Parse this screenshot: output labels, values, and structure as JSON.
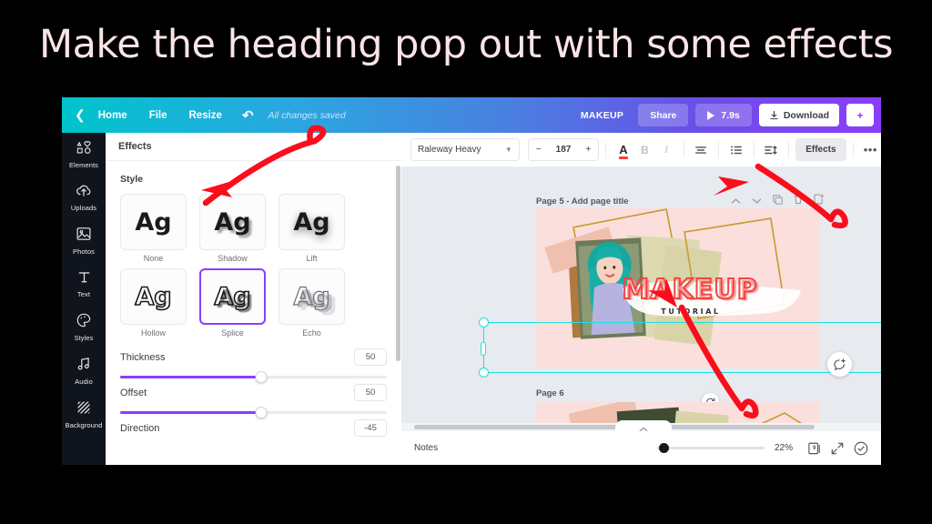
{
  "title": "Make the heading pop out with some effects",
  "topbar": {
    "back_icon": "chevron-left-icon",
    "home": "Home",
    "file": "File",
    "resize": "Resize",
    "undo_icon": "undo-icon",
    "saved_status": "All changes saved",
    "project_name": "MAKEUP",
    "share": "Share",
    "play_duration": "7.9s",
    "download": "Download",
    "gradient_start": "#00c4cc",
    "gradient_end": "#8b3dfb"
  },
  "rail": {
    "items": [
      {
        "label": "Elements",
        "icon": "shapes-icon"
      },
      {
        "label": "Uploads",
        "icon": "cloud-upload-icon"
      },
      {
        "label": "Photos",
        "icon": "image-icon"
      },
      {
        "label": "Text",
        "icon": "text-icon"
      },
      {
        "label": "Styles",
        "icon": "palette-icon"
      },
      {
        "label": "Audio",
        "icon": "music-note-icon"
      },
      {
        "label": "Background",
        "icon": "hatch-pattern-icon"
      }
    ]
  },
  "panel": {
    "header": "Effects",
    "style_label": "Style",
    "styles": [
      {
        "name": "None",
        "selected": false
      },
      {
        "name": "Shadow",
        "selected": false
      },
      {
        "name": "Lift",
        "selected": false
      },
      {
        "name": "Hollow",
        "selected": false
      },
      {
        "name": "Splice",
        "selected": true
      },
      {
        "name": "Echo",
        "selected": false
      }
    ],
    "sample_glyph": "Ag",
    "selected_color": "#8b3dfb",
    "sliders": [
      {
        "label": "Thickness",
        "value": "50"
      },
      {
        "label": "Offset",
        "value": "50"
      },
      {
        "label": "Direction",
        "value": "-45"
      }
    ]
  },
  "formatbar": {
    "font_name": "Raleway Heavy",
    "chevron_icon": "chevron-down-icon",
    "minus": "−",
    "font_size": "187",
    "plus": "+",
    "text_color_icon": "text-color-icon",
    "text_color": "#ff3b30",
    "bold_icon": "bold-icon",
    "bold_glyph": "B",
    "italic_icon": "italic-icon",
    "italic_glyph": "I",
    "align_icon": "align-center-icon",
    "list_icon": "bullet-list-icon",
    "spacing_icon": "line-spacing-icon",
    "effects_button": "Effects",
    "more_icon": "more-horizontal-icon",
    "more_glyph": "•••"
  },
  "canvas": {
    "page5_title": "Page 5 - Add page title",
    "page6_title": "Page 6",
    "page_controls": [
      {
        "icon": "chevron-up-icon",
        "glyph": "⌃"
      },
      {
        "icon": "chevron-down-icon",
        "glyph": "⌄"
      },
      {
        "icon": "duplicate-icon",
        "glyph": ""
      },
      {
        "icon": "trash-icon",
        "glyph": ""
      },
      {
        "icon": "add-page-icon",
        "glyph": ""
      }
    ],
    "design": {
      "heading": "MAKEUP",
      "subheading": "TUTORIAL",
      "heading_color": "#f0453f",
      "background_color": "#fbdfdc"
    },
    "rotate_icon": "rotate-icon",
    "comment_icon": "add-comment-icon",
    "selection_color": "#1ee0e0",
    "notes_tab_icon": "chevron-up-icon"
  },
  "bottombar": {
    "notes": "Notes",
    "zoom_percent": "22%",
    "page_count": "9",
    "page_manager_icon": "page-manager-icon",
    "fullscreen_icon": "expand-icon",
    "help_icon": "help-check-icon"
  },
  "annotations": {
    "color": "#fb0d1b",
    "arrows": [
      {
        "name": "arrow-to-style-panel"
      },
      {
        "name": "arrow-to-effects-button"
      },
      {
        "name": "arrow-to-heading-text"
      },
      {
        "name": "arrow-to-page-thumbnail"
      }
    ]
  }
}
